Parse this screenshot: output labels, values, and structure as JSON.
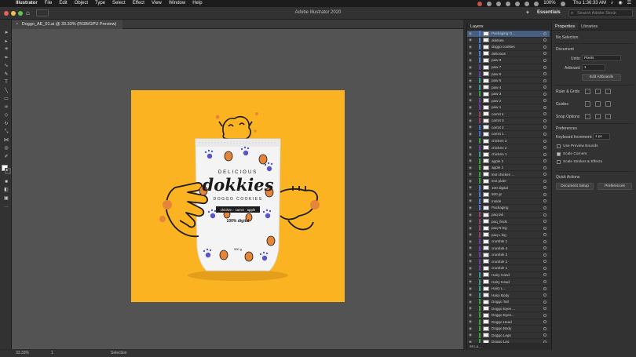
{
  "menubar": {
    "app_name": "Illustrator",
    "items": [
      "File",
      "Edit",
      "Object",
      "Type",
      "Select",
      "Effect",
      "View",
      "Window",
      "Help"
    ],
    "battery": "100%",
    "clock": "Thu 1:36:33 AM"
  },
  "appbar": {
    "window_title": "Adobe Illustrator 2020",
    "workspace": "Essentials",
    "search_placeholder": "Search Adobe Stock"
  },
  "document": {
    "tab_title": "Doggo_AE_01.ai @ 33.33% (RGB/GPU Preview)"
  },
  "status": {
    "zoom": "33.33%",
    "artboard": "1",
    "tool": "Selection"
  },
  "layers_panel": {
    "title": "Layers",
    "footer": "99 La...",
    "rows": [
      {
        "name": "Packaging G...",
        "color": "#4f7bd6",
        "selected": true
      },
      {
        "name": "dokkies",
        "color": "#4f7bd6"
      },
      {
        "name": "doggo cookies",
        "color": "#4f7bd6"
      },
      {
        "name": "delicious",
        "color": "#4f7bd6"
      },
      {
        "name": "paw 8",
        "color": "#4f7bd6"
      },
      {
        "name": "paw 7",
        "color": "#6a3fa8"
      },
      {
        "name": "paw 6",
        "color": "#6a3fa8"
      },
      {
        "name": "paw 5",
        "color": "#2f9e8f"
      },
      {
        "name": "paw 4",
        "color": "#2f9e8f"
      },
      {
        "name": "paw 3",
        "color": "#3a9e3f"
      },
      {
        "name": "paw 2",
        "color": "#6a3fa8"
      },
      {
        "name": "paw 1",
        "color": "#6a3fa8"
      },
      {
        "name": "carrot 4",
        "color": "#9b3f6a"
      },
      {
        "name": "carrot 3",
        "color": "#9b3f6a"
      },
      {
        "name": "carrot 2",
        "color": "#3f6ad6"
      },
      {
        "name": "carrot 1",
        "color": "#3f6ad6"
      },
      {
        "name": "chicken 3",
        "color": "#3a9e3f"
      },
      {
        "name": "chicken 2",
        "color": "#6a3fa8"
      },
      {
        "name": "chicken 1",
        "color": "#2f9e8f"
      },
      {
        "name": "apple 2",
        "color": "#3a9e3f"
      },
      {
        "name": "apple 1",
        "color": "#3a9e3f"
      },
      {
        "name": "text chicken ...",
        "color": "#3a9e3f"
      },
      {
        "name": "text plate",
        "color": "#3a9e3f"
      },
      {
        "name": "100 digital",
        "color": "#4f7bd6"
      },
      {
        "name": "500 gr",
        "color": "#4f7bd6"
      },
      {
        "name": "Inside",
        "color": "#4f7bd6"
      },
      {
        "name": "Packaging",
        "color": "#4f7bd6"
      },
      {
        "name": "paq tail",
        "color": "#9b3f6a"
      },
      {
        "name": "paq_finds",
        "color": "#9b3f6a"
      },
      {
        "name": "paq R leg",
        "color": "#9b3f6a"
      },
      {
        "name": "paq L leg",
        "color": "#9b3f6a"
      },
      {
        "name": "crumble 1",
        "color": "#6a3fa8"
      },
      {
        "name": "crumble 4",
        "color": "#6a3fa8"
      },
      {
        "name": "crumble 3",
        "color": "#6a3fa8"
      },
      {
        "name": "crumble 2",
        "color": "#6a3fa8"
      },
      {
        "name": "crumble 1",
        "color": "#6a3fa8"
      },
      {
        "name": "Hairy Hand",
        "color": "#2f9e8f"
      },
      {
        "name": "Hairy Head",
        "color": "#2f9e8f"
      },
      {
        "name": "Hairy L...",
        "color": "#2f9e8f"
      },
      {
        "name": "Hairy Body",
        "color": "#2f9e8f"
      },
      {
        "name": "Doggo Tail",
        "color": "#3a9e3f"
      },
      {
        "name": "Doggo Eyes ...",
        "color": "#3a9e3f"
      },
      {
        "name": "Doggo Eyes...",
        "color": "#3a9e3f"
      },
      {
        "name": "Doggo Head",
        "color": "#3a9e3f"
      },
      {
        "name": "Doggo Body",
        "color": "#3a9e3f"
      },
      {
        "name": "Doggo Legs",
        "color": "#3a9e3f"
      },
      {
        "name": "Doggo Leg",
        "color": "#3a9e3f"
      }
    ]
  },
  "properties_panel": {
    "tabs": [
      "Properties",
      "Libraries"
    ],
    "no_selection": "No Selection",
    "document_label": "Document",
    "units_label": "Units:",
    "units_value": "Pixels",
    "artboard_label": "Artboard:",
    "artboard_value": "1",
    "edit_artboards": "Edit Artboards",
    "ruler_grids": "Ruler & Grids",
    "guides": "Guides",
    "snap_options": "Snap Options",
    "preferences_label": "Preferences",
    "keyboard_increment_label": "Keyboard Increment:",
    "keyboard_increment_value": "1 px",
    "use_preview_bounds": "Use Preview Bounds",
    "scale_corners": "Scale Corners",
    "scale_strokes": "Scale Strokes & Effects",
    "quick_actions": "Quick Actions",
    "document_setup": "Document Setup",
    "preferences_button": "Preferences"
  },
  "artwork": {
    "brand": "dokkies",
    "tagline_top": "DELICIOUS",
    "tagline_bottom": "DOGGO COOKIES",
    "flavor": "chicken · carrot · apple",
    "digital": "100% digital",
    "weight": "500 g",
    "background_color": "#fbb321",
    "pouch_color": "#f4f4f4",
    "ink_color": "#1b1b1b",
    "paw_color": "#5b55c9",
    "cookie_color": "#e4853a"
  }
}
